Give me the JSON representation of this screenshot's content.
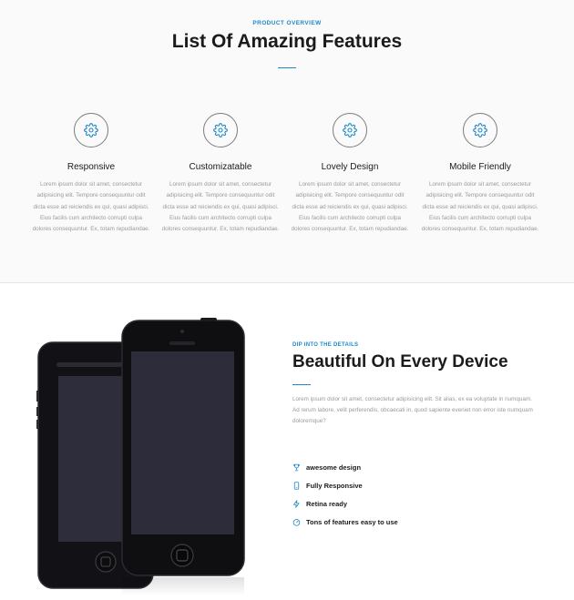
{
  "features_section": {
    "overline": "PRODUCT OVERVIEW",
    "title": "List Of Amazing Features",
    "items": [
      {
        "icon": "gear-icon",
        "title": "Responsive",
        "body": "Lorem ipsum dolor sit amet, consectetur adipisicing elit. Tempore consequuntur odit dicta esse ad reiciendis ex qui, quasi adipisci. Eius facilis cum architecto corrupti culpa dolores consequuntur. Ex, totam repudiandae."
      },
      {
        "icon": "gear-icon",
        "title": "Customizatable",
        "body": "Lorem ipsum dolor sit amet, consectetur adipisicing elit. Tempore consequuntur odit dicta esse ad reiciendis ex qui, quasi adipisci. Eius facilis cum architecto corrupti culpa dolores consequuntur. Ex, totam repudiandae."
      },
      {
        "icon": "gear-icon",
        "title": "Lovely Design",
        "body": "Lorem ipsum dolor sit amet, consectetur adipisicing elit. Tempore consequuntur odit dicta esse ad reiciendis ex qui, quasi adipisci. Eius facilis cum architecto corrupti culpa dolores consequuntur. Ex, totam repudiandae."
      },
      {
        "icon": "gear-icon",
        "title": "Mobile Friendly",
        "body": "Lorem ipsum dolor sit amet, consectetur adipisicing elit. Tempore consequuntur odit dicta esse ad reiciendis ex qui, quasi adipisci. Eius facilis cum architecto corrupti culpa dolores consequuntur. Ex, totam repudiandae."
      }
    ]
  },
  "details_section": {
    "overline": "DIP INTO THE DETAILS",
    "title": "Beautiful On Every Device",
    "body": "Lorem ipsum dolor sit amet, consectetur adipisicing elit. Sit alias, ex ea voluptate in numquam. Ad rerum labore, velit perferendis, obcaecati in, quod sapiente eveniet non error iste numquam doloremque?",
    "list": [
      {
        "icon": "trophy-icon",
        "label": "awesome design"
      },
      {
        "icon": "mobile-icon",
        "label": "Fully Responsive"
      },
      {
        "icon": "bolt-icon",
        "label": "Retina ready"
      },
      {
        "icon": "gauge-icon",
        "label": "Tons of features easy to use"
      }
    ]
  },
  "colors": {
    "accent": "#1e88c7",
    "heading": "#1b1b1b",
    "muted": "#9a9a9a"
  }
}
